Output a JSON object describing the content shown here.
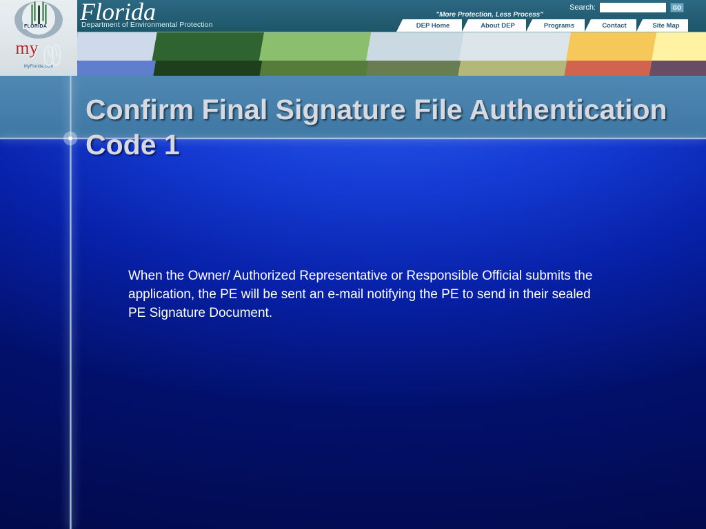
{
  "header": {
    "state": "Florida",
    "department": "Department of Environmental Protection",
    "seal_label": "FLORIDA",
    "myflorida": "my",
    "myflorida_domain": "MyFlorida.com",
    "tagline": "\"More Protection, Less Process\"",
    "search_label": "Search:",
    "search_value": "",
    "go_label": "GO",
    "nav": [
      "DEP Home",
      "About DEP",
      "Programs",
      "Contact",
      "Site Map"
    ]
  },
  "slide": {
    "title": "Confirm Final Signature File Authentication Code 1",
    "body": "When the Owner/ Authorized Representative or Responsible Official submits the application, the PE will be sent an e-mail notifying the PE to send in their sealed PE Signature Document."
  }
}
